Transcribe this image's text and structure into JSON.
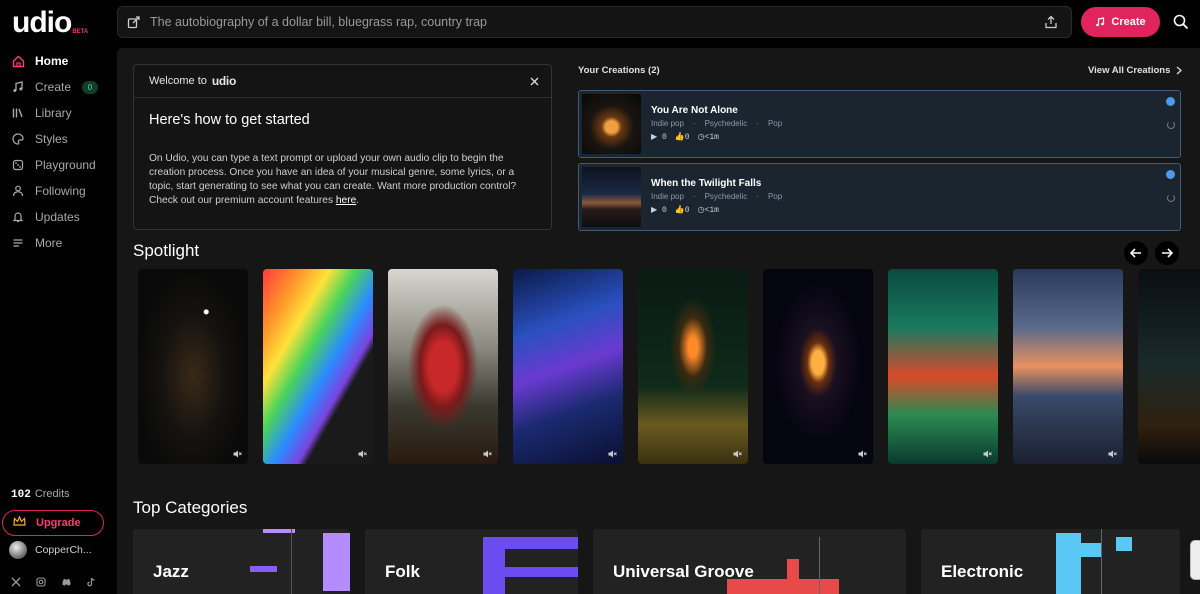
{
  "app": {
    "logo_text": "udio",
    "beta_label": "BETA",
    "accent_color": "#e0245e"
  },
  "topbar": {
    "prompt_placeholder": "The autobiography of a dollar bill, bluegrass rap, country trap",
    "create_label": "Create"
  },
  "sidebar": {
    "items": [
      {
        "label": "Home",
        "icon": "home-icon",
        "active": true
      },
      {
        "label": "Create",
        "icon": "music-note-icon",
        "badge": "0"
      },
      {
        "label": "Library",
        "icon": "library-icon"
      },
      {
        "label": "Styles",
        "icon": "palette-icon"
      },
      {
        "label": "Playground",
        "icon": "dice-icon"
      },
      {
        "label": "Following",
        "icon": "person-icon"
      },
      {
        "label": "Updates",
        "icon": "bell-icon"
      },
      {
        "label": "More",
        "icon": "menu-icon"
      }
    ],
    "credits_value": "102",
    "credits_label": "Credits",
    "upgrade_label": "Upgrade",
    "username": "CopperCh..."
  },
  "welcome": {
    "header_prefix": "Welcome to",
    "header_brand": "udio",
    "title": "Here's how to get started",
    "body": "On Udio, you can type a text prompt or upload your own audio clip to begin the creation process. Once you have an idea of your musical genre, some lyrics, or a topic, start generating to see what you can create. Want more production control? Check out our premium account features ",
    "link_text": "here",
    "body_end": "."
  },
  "creations": {
    "title": "Your Creations (2)",
    "view_all": "View All Creations",
    "tracks": [
      {
        "title": "You Are Not Alone",
        "tags": [
          "Indie pop",
          "Psychedelic",
          "Pop"
        ],
        "plays": "0",
        "likes": "0",
        "duration": "<1m"
      },
      {
        "title": "When the Twilight Falls",
        "tags": [
          "Indie pop",
          "Psychedelic",
          "Pop"
        ],
        "plays": "0",
        "likes": "0",
        "duration": "<1m"
      }
    ]
  },
  "spotlight": {
    "title": "Spotlight",
    "cards": [
      "crescent-moon-art",
      "rainbow-portal-art",
      "red-dress-dancer-art",
      "aurora-skeleton-art",
      "burning-rider-art",
      "space-ring-art",
      "abstract-figure-art",
      "lone-figure-sunset-art",
      "night-road-art"
    ]
  },
  "categories": {
    "title": "Top Categories",
    "items": [
      "Jazz",
      "Folk",
      "Universal Groove",
      "Electronic"
    ]
  }
}
